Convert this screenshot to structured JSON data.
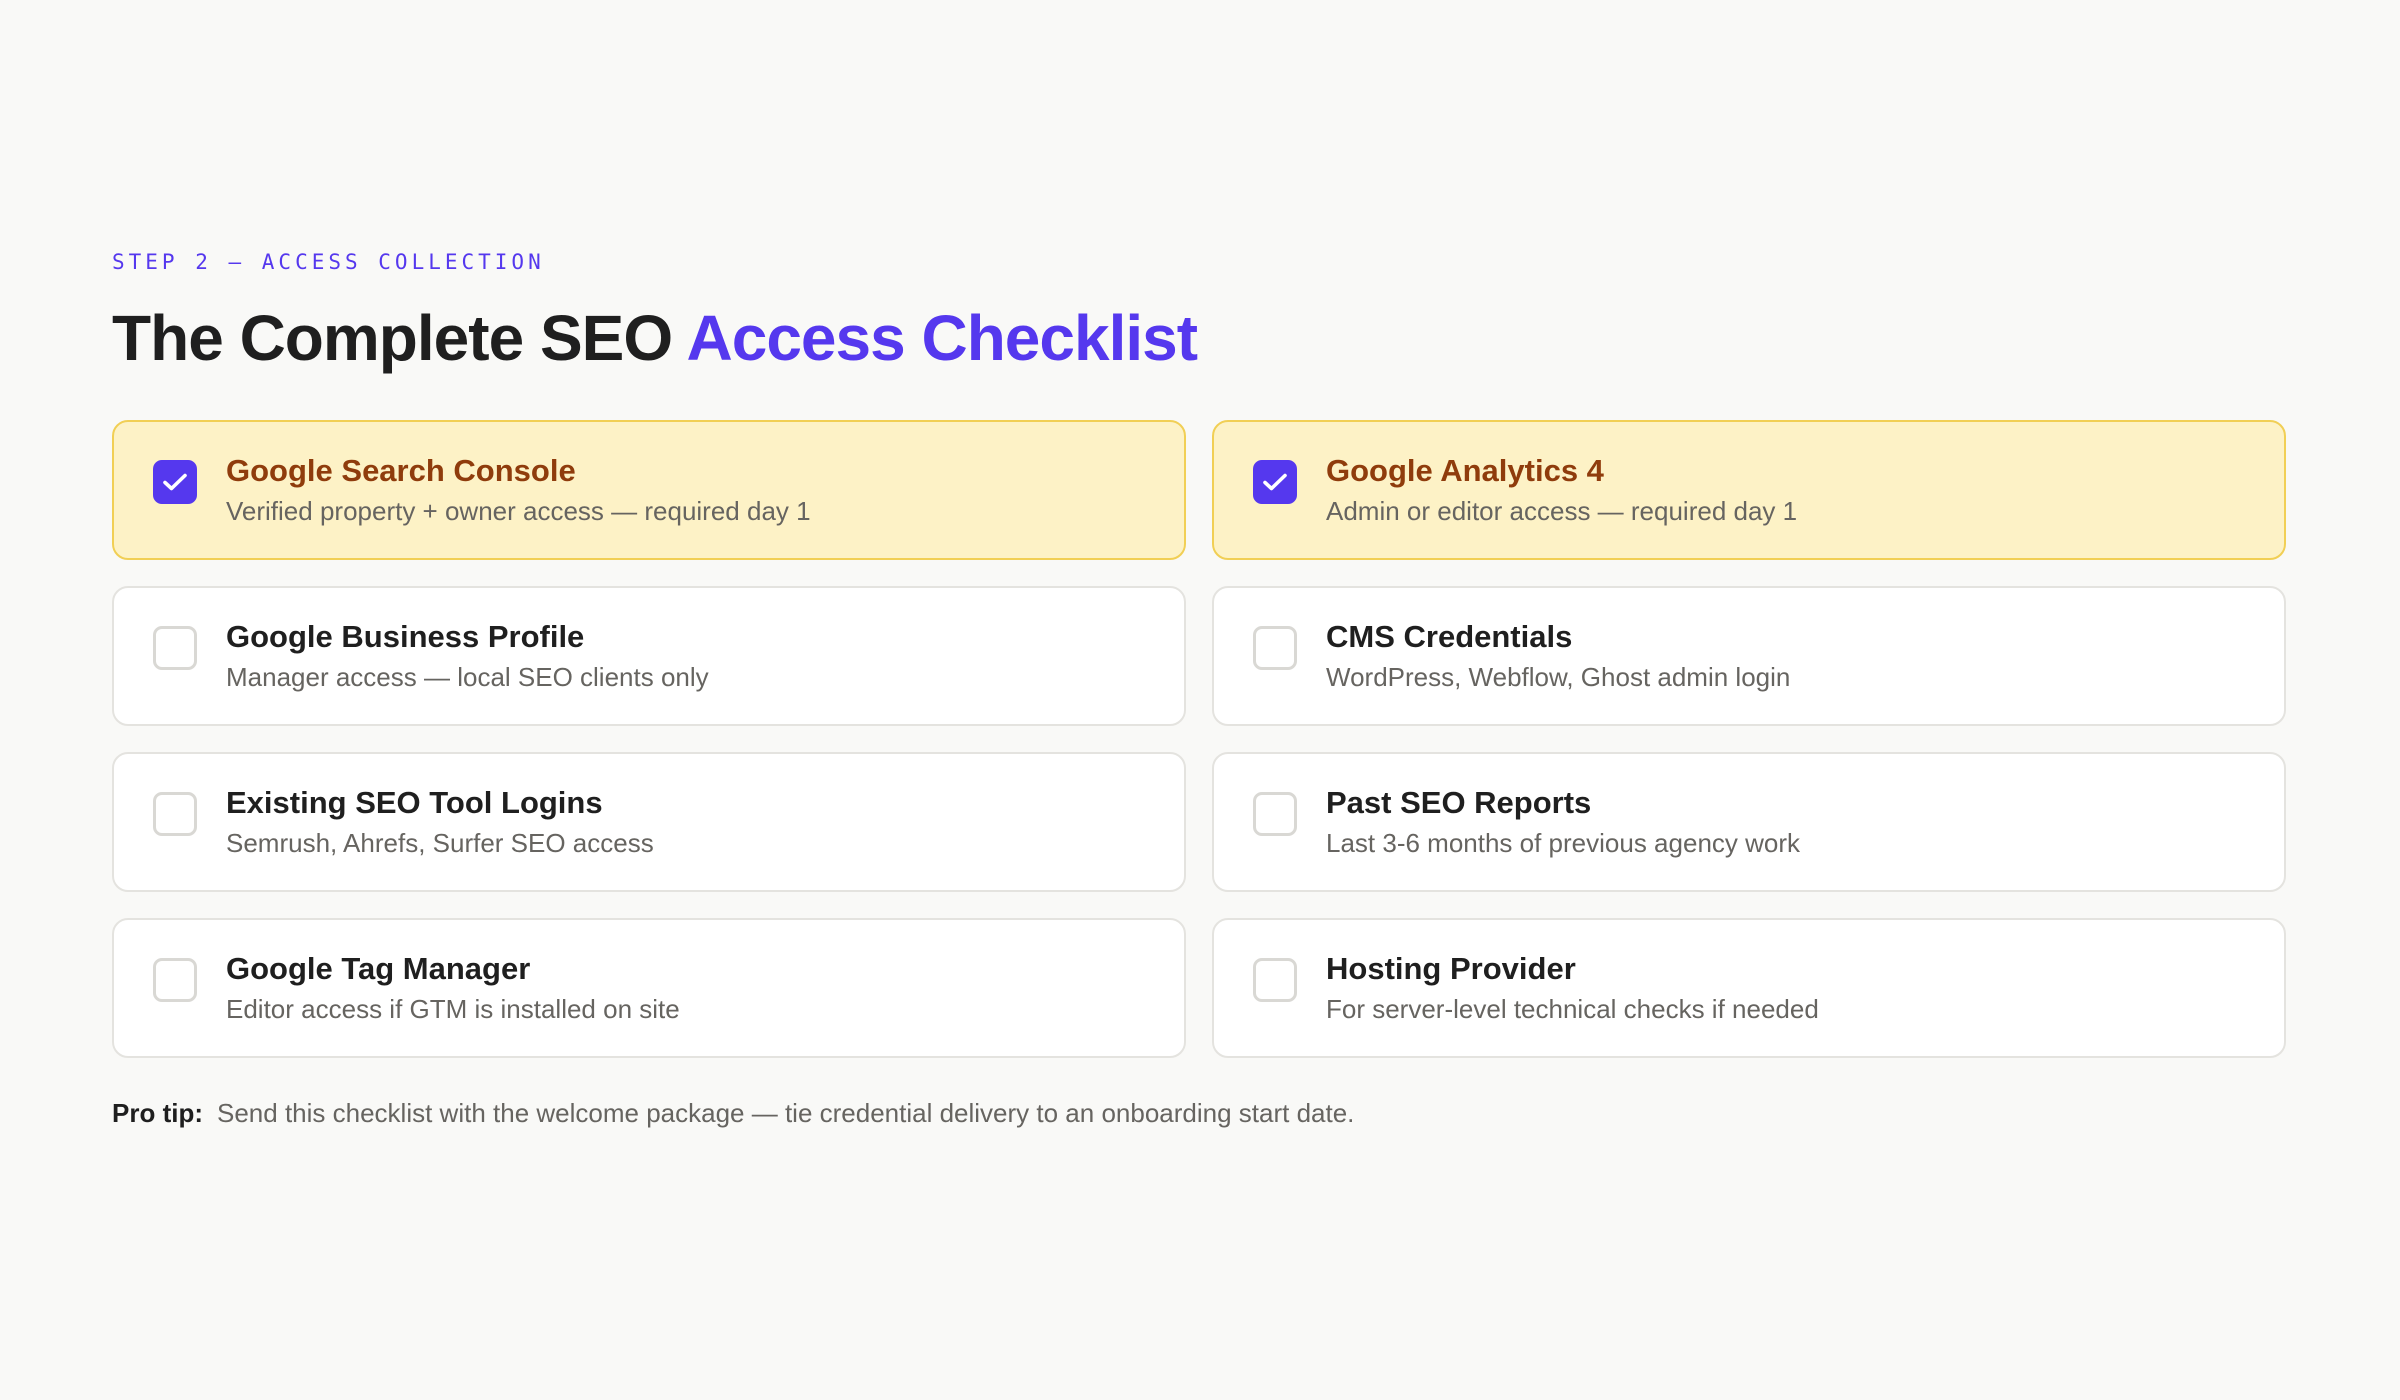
{
  "header": {
    "eyebrow": "STEP 2 — ACCESS COLLECTION",
    "title_main": "The Complete SEO ",
    "title_accent": "Access Checklist"
  },
  "colors": {
    "accent": "#5538ee",
    "checked_background": "#fdf2c6",
    "checked_border": "#f1cf55",
    "checked_title": "#8f3c0c"
  },
  "checklist": {
    "items": [
      {
        "title": "Google Search Console",
        "description": "Verified property + owner access — required day 1",
        "checked": true
      },
      {
        "title": "Google Analytics 4",
        "description": "Admin or editor access — required day 1",
        "checked": true
      },
      {
        "title": "Google Business Profile",
        "description": "Manager access — local SEO clients only",
        "checked": false
      },
      {
        "title": "CMS Credentials",
        "description": "WordPress, Webflow, Ghost admin login",
        "checked": false
      },
      {
        "title": "Existing SEO Tool Logins",
        "description": "Semrush, Ahrefs, Surfer SEO access",
        "checked": false
      },
      {
        "title": "Past SEO Reports",
        "description": "Last 3-6 months of previous agency work",
        "checked": false
      },
      {
        "title": "Google Tag Manager",
        "description": "Editor access if GTM is installed on site",
        "checked": false
      },
      {
        "title": "Hosting Provider",
        "description": "For server-level technical checks if needed",
        "checked": false
      }
    ]
  },
  "footer": {
    "tip_label": "Pro tip:",
    "tip_text": "Send this checklist with the welcome package — tie credential delivery to an onboarding start date."
  },
  "icons": {
    "checkbox_checked": "checkmark-icon"
  }
}
